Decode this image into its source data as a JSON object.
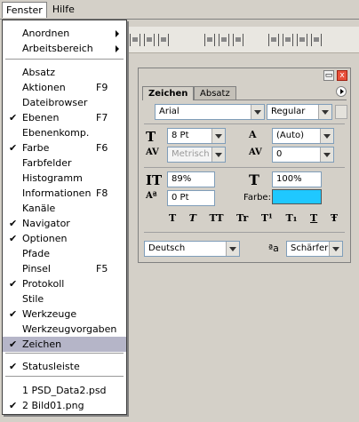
{
  "menubar": {
    "items": [
      {
        "label": "Fenster",
        "active": true
      },
      {
        "label": "Hilfe",
        "active": false
      }
    ]
  },
  "menu": {
    "items": [
      {
        "label": "Anordnen",
        "submenu": true
      },
      {
        "label": "Arbeitsbereich",
        "submenu": true
      },
      {
        "label": "Absatz"
      },
      {
        "label": "Aktionen",
        "shortcut": "F9"
      },
      {
        "label": "Dateibrowser"
      },
      {
        "label": "Ebenen",
        "shortcut": "F7",
        "checked": true
      },
      {
        "label": "Ebenenkomp."
      },
      {
        "label": "Farbe",
        "shortcut": "F6",
        "checked": true
      },
      {
        "label": "Farbfelder"
      },
      {
        "label": "Histogramm"
      },
      {
        "label": "Informationen",
        "shortcut": "F8"
      },
      {
        "label": "Kanäle"
      },
      {
        "label": "Navigator",
        "checked": true
      },
      {
        "label": "Optionen",
        "checked": true
      },
      {
        "label": "Pfade"
      },
      {
        "label": "Pinsel",
        "shortcut": "F5"
      },
      {
        "label": "Protokoll",
        "checked": true
      },
      {
        "label": "Stile"
      },
      {
        "label": "Werkzeuge",
        "checked": true
      },
      {
        "label": "Werkzeugvorgaben"
      },
      {
        "label": "Zeichen",
        "checked": true,
        "selected": true
      },
      {
        "label": "Statusleiste",
        "checked": true
      },
      {
        "label": "1 PSD_Data2.psd"
      },
      {
        "label": "2 Bild01.png",
        "checked": true
      }
    ]
  },
  "panel": {
    "tabs": [
      "Zeichen",
      "Absatz"
    ],
    "font_family": "Arial",
    "font_style": "Regular",
    "font_size": "8 Pt",
    "leading": "(Auto)",
    "kerning": "Metrisch",
    "tracking": "0",
    "vertical_scale": "89%",
    "horizontal_scale": "100%",
    "baseline_shift": "0 Pt",
    "color_label": "Farbe:",
    "color_value": "#1fc8ff",
    "style_buttons": [
      "T",
      "T",
      "TT",
      "Tr",
      "T¹",
      "T₁",
      "T",
      "Ŧ"
    ],
    "language": "Deutsch",
    "antialias_prefix": "ªa",
    "antialias": "Schärfer",
    "min_icon": "▭",
    "close_icon": "x"
  },
  "icons": {
    "check": "✔"
  }
}
